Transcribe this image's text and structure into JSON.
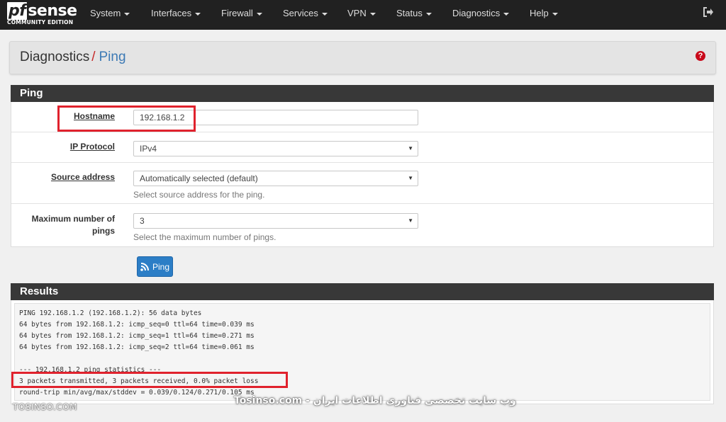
{
  "brand": {
    "logo_text": "sense",
    "logo_pf": "pf",
    "edition": "COMMUNITY EDITION"
  },
  "nav": {
    "items": [
      {
        "label": "System"
      },
      {
        "label": "Interfaces"
      },
      {
        "label": "Firewall"
      },
      {
        "label": "Services"
      },
      {
        "label": "VPN"
      },
      {
        "label": "Status"
      },
      {
        "label": "Diagnostics"
      },
      {
        "label": "Help"
      }
    ],
    "logout_icon": "logout-icon"
  },
  "breadcrumb": {
    "root": "Diagnostics",
    "separator": "/",
    "current": "Ping",
    "help_symbol": "?"
  },
  "ping_panel": {
    "title": "Ping",
    "hostname": {
      "label": "Hostname",
      "value": "192.168.1.2"
    },
    "ip_protocol": {
      "label": "IP Protocol",
      "value": "IPv4"
    },
    "source_address": {
      "label": "Source address",
      "value": "Automatically selected (default)",
      "hint": "Select source address for the ping."
    },
    "max_pings": {
      "label_line1": "Maximum number of",
      "label_line2": "pings",
      "value": "3",
      "hint": "Select the maximum number of pings."
    },
    "submit_label": "Ping"
  },
  "results": {
    "title": "Results",
    "lines": [
      "PING 192.168.1.2 (192.168.1.2): 56 data bytes",
      "64 bytes from 192.168.1.2: icmp_seq=0 ttl=64 time=0.039 ms",
      "64 bytes from 192.168.1.2: icmp_seq=1 ttl=64 time=0.271 ms",
      "64 bytes from 192.168.1.2: icmp_seq=2 ttl=64 time=0.061 ms",
      "",
      "--- 192.168.1.2 ping statistics ---",
      "3 packets transmitted, 3 packets received, 0.0% packet loss",
      "round-trip min/avg/max/stddev = 0.039/0.124/0.271/0.105 ms"
    ]
  },
  "watermarks": {
    "left": "TOSINSO.COM",
    "center": "Tosinso.com - وب سایت تخصصی فناوری اطلاعات ایران"
  },
  "colors": {
    "navbar": "#212121",
    "panel_header": "#383838",
    "accent_blue": "#2c7ec6",
    "highlight_red": "#e0222d",
    "help_red": "#c9091a"
  }
}
